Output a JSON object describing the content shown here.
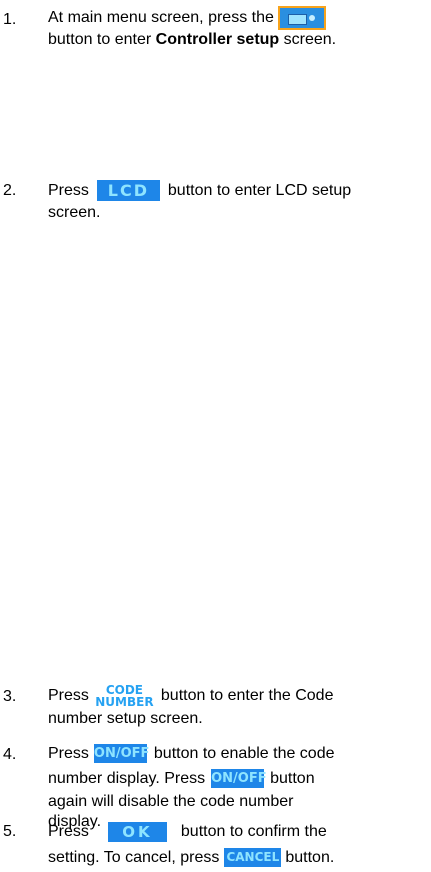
{
  "steps": [
    {
      "number": "1.",
      "pre": "At main menu screen, press the",
      "line2_post": "button to enter",
      "bold": "Controller setup",
      "post": "screen.",
      "icon": "controller-setup-icon"
    },
    {
      "number": "2.",
      "pre": "Press",
      "button": "LCD",
      "post": "button to enter LCD setup",
      "line2": "screen."
    },
    {
      "number": "3.",
      "pre": "Press",
      "button_top": "CODE",
      "button_bottom": "NUMBER",
      "post": "button to enter the Code",
      "line2": "number setup screen."
    },
    {
      "number": "4.",
      "pre": "Press",
      "button": "ON/OFF",
      "post": "button to enable the code",
      "line2_pre": "number display. Press",
      "line2_button": "ON/OFF",
      "line2_post": "button",
      "line3": "again will disable the code number",
      "line4": "display."
    },
    {
      "number": "5.",
      "pre": "Press",
      "button": "OK",
      "post": "button to confirm the",
      "line2_pre": "setting. To cancel, press",
      "line2_button": "CANCEL",
      "line2_post": "button."
    }
  ],
  "colors": {
    "button_bg": "#1e86e8",
    "button_text": "#8ee4ff",
    "menu_button_border": "#f7a31c"
  }
}
